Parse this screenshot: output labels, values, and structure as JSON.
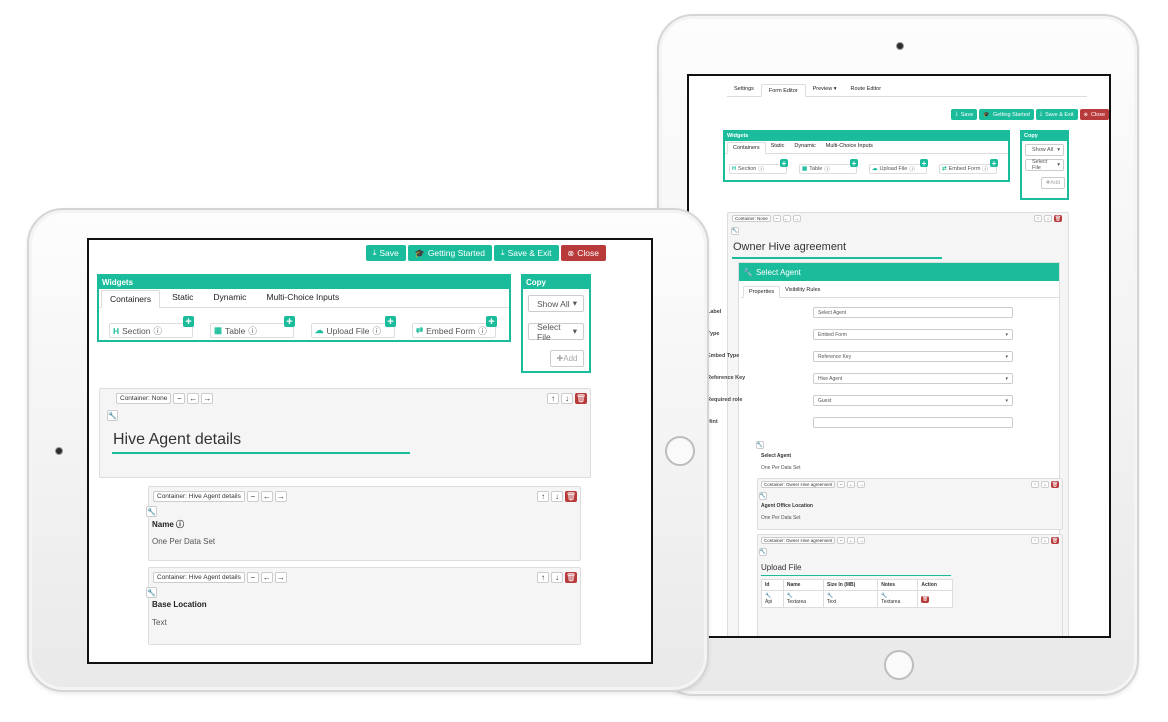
{
  "icons": {
    "save": "download-icon",
    "getting_started": "graduation-cap-icon",
    "save_exit": "download-icon",
    "close": "x-circle-icon",
    "info": "info-circle-icon",
    "wrench": "wrench-icon",
    "minus": "minus-icon",
    "left": "arrow-left-icon",
    "right": "arrow-right-icon",
    "up": "arrow-up-icon",
    "down": "arrow-down-icon",
    "trash": "trash-icon"
  },
  "colors": {
    "accent": "#1abc9c",
    "danger": "#b83a3a"
  },
  "toolbar": {
    "save": "Save",
    "getting_started": "Getting Started",
    "save_exit": "Save & Exit",
    "close": "Close"
  },
  "widgets": {
    "title": "Widgets",
    "tabs": [
      "Containers",
      "Static",
      "Dynamic",
      "Multi-Choice Inputs"
    ],
    "items": [
      {
        "icon": "H",
        "label": "Section"
      },
      {
        "icon": "▦",
        "label": "Table"
      },
      {
        "icon": "☁",
        "label": "Upload File"
      },
      {
        "icon": "⇄",
        "label": "Embed Form"
      }
    ]
  },
  "copy": {
    "title": "Copy",
    "show_all": "Show All",
    "select_file": "Select File",
    "add": "Add"
  },
  "front": {
    "root_container": "Container: None",
    "section_title": "Hive Agent details",
    "fields": [
      {
        "container": "Container: Hive Agent details",
        "label": "Name",
        "value": "One Per Data Set"
      },
      {
        "container": "Container: Hive Agent details",
        "label": "Base Location",
        "value": "Text"
      }
    ]
  },
  "back": {
    "top_tabs": [
      "Settings",
      "Form Editor",
      "Preview ▾",
      "Route Editor"
    ],
    "root_container": "Container: None",
    "section_title": "Owner Hive agreement",
    "agent_panel_title": "Select Agent",
    "agent_tabs": [
      "Properties",
      "Visibility Rules"
    ],
    "properties": [
      {
        "label": "Label",
        "value": "Select Agent"
      },
      {
        "label": "Type",
        "value": "Embed Form"
      },
      {
        "label": "Embed Type",
        "value": "Reference Key"
      },
      {
        "label": "Reference Key",
        "value": "Hive Agent"
      },
      {
        "label": "Required role",
        "value": "Guest"
      },
      {
        "label": "Hint",
        "value": ""
      }
    ],
    "preview": {
      "label": "Select Agent",
      "value": "One Per Data Set"
    },
    "sub_container": "Container: Owner Hive agreement",
    "office": {
      "label": "Agent Office Location",
      "value": "One Per Data Set"
    },
    "upload_title": "Upload File",
    "table": {
      "headers": [
        "Id",
        "Name",
        "Size In (MB)",
        "Notes",
        "Action"
      ],
      "row": [
        "Api",
        "Textarea",
        "Text",
        "Textarea"
      ]
    }
  }
}
